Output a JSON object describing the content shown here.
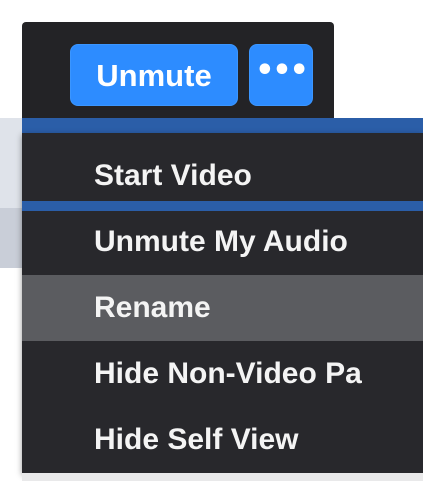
{
  "controls": {
    "unmute_label": "Unmute",
    "more_label": "•••",
    "more_icon": "ellipsis-icon"
  },
  "menu": {
    "items": [
      {
        "label": "Start Video",
        "highlighted": false
      },
      {
        "label": "Unmute My Audio",
        "highlighted": false
      },
      {
        "label": "Rename",
        "highlighted": true
      },
      {
        "label": "Hide Non-Video Pa",
        "highlighted": false
      },
      {
        "label": "Hide Self View",
        "highlighted": false
      }
    ]
  },
  "colors": {
    "button_blue": "#2d8cff",
    "menu_background": "#28282c",
    "hover_background": "#5b5c60",
    "accent_band": "#2b5ea8",
    "text": "#f4f4f4"
  }
}
